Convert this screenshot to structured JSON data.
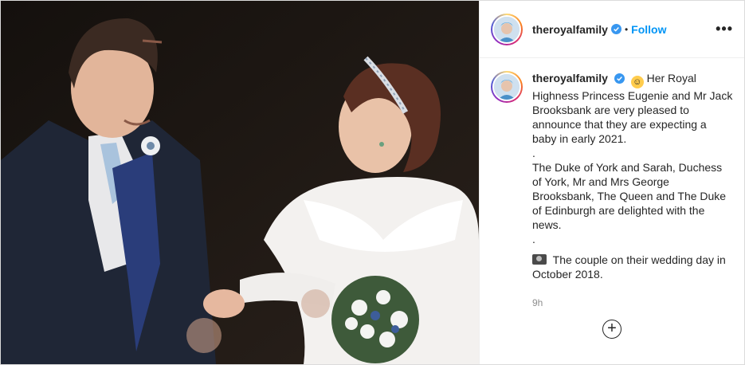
{
  "post": {
    "image_alt": "Princess Eugenie and Jack Brooksbank on their wedding day",
    "account": {
      "username": "theroyalfamily",
      "verified": true,
      "follow_label": "Follow",
      "separator": "•",
      "more_label": "•••"
    },
    "caption": {
      "username": "theroyalfamily",
      "lines": [
        "Her Royal Highness Princess Eugenie and Mr Jack Brooksbank are very pleased to announce that they are expecting a baby in early 2021.",
        ".",
        "The Duke of York and Sarah, Duchess of York, Mr and Mrs George Brooksbank, The Queen and The Duke of Edinburgh are delighted with the news.",
        ".",
        "The couple on their wedding day in October 2018."
      ],
      "timestamp": "9h"
    },
    "load_more_label": "+"
  },
  "colors": {
    "accent": "#0095f6",
    "verified": "#3897f0",
    "text": "#262626",
    "muted": "#8e8e8e"
  },
  "icons": [
    "verified-badge-icon",
    "baby-emoji-icon",
    "camera-emoji-icon",
    "more-options-icon",
    "load-more-comments-icon"
  ]
}
